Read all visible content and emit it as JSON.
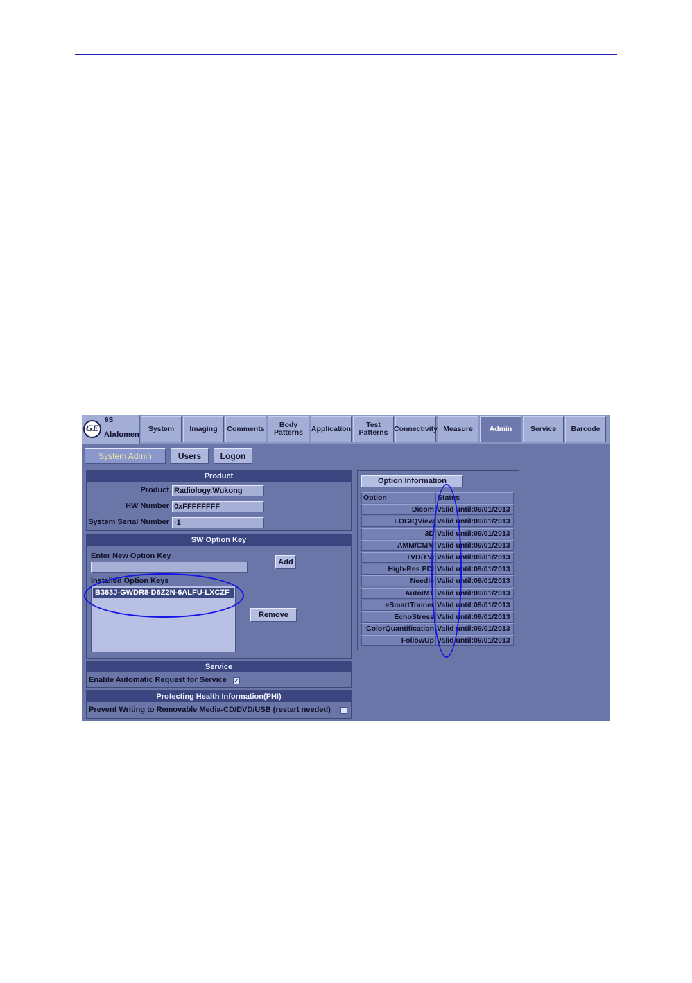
{
  "header": {
    "rule_color": "#1f1fb0"
  },
  "app": {
    "probe": "6S",
    "preset": "Abdomen",
    "tabs": [
      {
        "label": "System",
        "active": false
      },
      {
        "label": "Imaging",
        "active": false
      },
      {
        "label": "Comments",
        "active": false
      },
      {
        "label": "Body\nPatterns",
        "active": false
      },
      {
        "label": "Application",
        "active": false
      },
      {
        "label": "Test\nPatterns",
        "active": false
      },
      {
        "label": "Connectivity",
        "active": false
      },
      {
        "label": "Measure",
        "active": false
      },
      {
        "label": "Admin",
        "active": true
      },
      {
        "label": "Service",
        "active": false
      },
      {
        "label": "Barcode",
        "active": false
      }
    ],
    "subtabs": [
      {
        "label": "System Admin",
        "active": true
      },
      {
        "label": "Users",
        "active": false
      },
      {
        "label": "Logon",
        "active": false
      }
    ]
  },
  "product": {
    "title": "Product",
    "product_label": "Product",
    "product_value": "Radiology.Wukong",
    "hw_label": "HW Number",
    "hw_value": "0xFFFFFFFF",
    "serial_label": "System Serial Number",
    "serial_value": "-1"
  },
  "sw_option_key": {
    "title": "SW Option Key",
    "enter_label": "Enter New Option Key",
    "enter_value": "",
    "add_label": "Add",
    "installed_label": "Installed Option Keys",
    "installed_keys": [
      "B363J-GWDR8-D6Z2N-6ALFU-LXCZF"
    ],
    "remove_label": "Remove"
  },
  "service": {
    "title": "Service",
    "auto_request_label": "Enable Automatic Request for Service",
    "auto_request_checked": true
  },
  "phi": {
    "title": "Protecting Health Information(PHI)",
    "prevent_label": "Prevent Writing to Removable Media-CD/DVD/USB (restart needed)",
    "prevent_checked": false
  },
  "option_info": {
    "button_label": "Option Information",
    "col_option": "Option",
    "col_status": "Status",
    "rows": [
      {
        "option": "Dicom",
        "status": "Valid until:09/01/2013"
      },
      {
        "option": "LOGIQView",
        "status": "Valid until:09/01/2013"
      },
      {
        "option": "3D",
        "status": "Valid until:09/01/2013"
      },
      {
        "option": "AMM/CMM",
        "status": "Valid until:09/01/2013"
      },
      {
        "option": "TVD/TVI",
        "status": "Valid until:09/01/2013"
      },
      {
        "option": "High-Res PDI",
        "status": "Valid until:09/01/2013"
      },
      {
        "option": "Needle",
        "status": "Valid until:09/01/2013"
      },
      {
        "option": "AutoIMT",
        "status": "Valid until:09/01/2013"
      },
      {
        "option": "eSmartTrainer",
        "status": "Valid until:09/01/2013"
      },
      {
        "option": "EchoStress",
        "status": "Valid until:09/01/2013"
      },
      {
        "option": "ColorQuantification",
        "status": "Valid until:09/01/2013"
      },
      {
        "option": "FollowUp",
        "status": "Valid until:09/01/2013"
      }
    ]
  },
  "annotations": {
    "color": "#1414e6"
  }
}
